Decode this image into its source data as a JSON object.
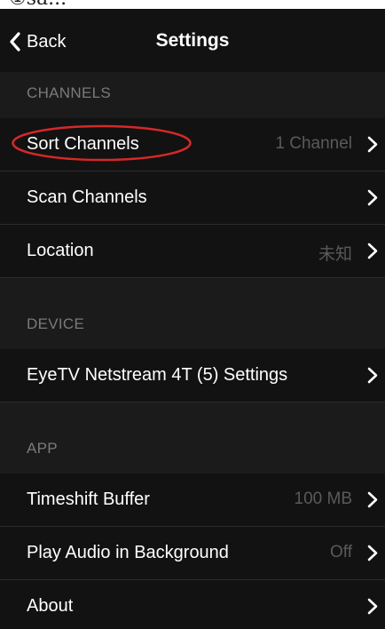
{
  "top_fragment": "①sa...",
  "nav": {
    "back_label": "Back",
    "title": "Settings"
  },
  "sections": {
    "channels": {
      "header": "CHANNELS",
      "rows": {
        "sort": {
          "label": "Sort Channels",
          "value": "1 Channel"
        },
        "scan": {
          "label": "Scan Channels"
        },
        "location": {
          "label": "Location",
          "value": "未知"
        }
      }
    },
    "device": {
      "header": "DEVICE",
      "rows": {
        "eyetv": {
          "label": "EyeTV Netstream 4T (5) Settings"
        }
      }
    },
    "app": {
      "header": "APP",
      "rows": {
        "timeshift": {
          "label": "Timeshift Buffer",
          "value": "100 MB"
        },
        "audio": {
          "label": "Play Audio in Background",
          "value": "Off"
        },
        "about": {
          "label": "About"
        }
      }
    }
  },
  "colors": {
    "background": "#121212",
    "section_header_bg": "#1b1b1b",
    "secondary_text": "#5a5a5a",
    "annotation": "#d62828"
  },
  "icons": {
    "back": "chevron-left-icon",
    "disclosure": "chevron-right-icon"
  }
}
